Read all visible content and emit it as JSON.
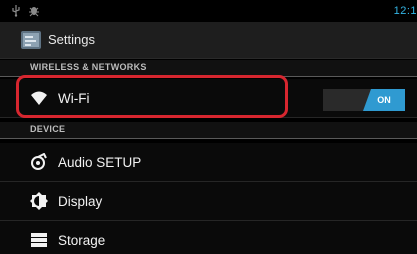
{
  "status_bar": {
    "time": "12:1",
    "icons": [
      "usb-icon",
      "debug-icon"
    ]
  },
  "action_bar": {
    "title": "Settings",
    "icon": "settings-app-icon"
  },
  "sections": [
    {
      "header": "WIRELESS & NETWORKS",
      "items": [
        {
          "label": "Wi-Fi",
          "icon": "wifi-icon",
          "toggle": "ON"
        }
      ]
    },
    {
      "header": "DEVICE",
      "items": [
        {
          "label": "Audio SETUP",
          "icon": "audio-icon"
        },
        {
          "label": "Display",
          "icon": "display-icon"
        },
        {
          "label": "Storage",
          "icon": "storage-icon"
        }
      ]
    }
  ],
  "colors": {
    "accent": "#33b5e5",
    "toggle_on": "#2f9ad1",
    "highlight": "#d7262f"
  }
}
